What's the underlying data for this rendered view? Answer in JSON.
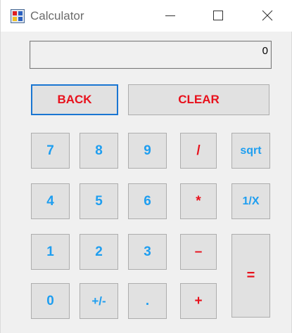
{
  "window": {
    "title": "Calculator"
  },
  "display": {
    "value": "0"
  },
  "buttons": {
    "back": "BACK",
    "clear": "CLEAR",
    "seven": "7",
    "eight": "8",
    "nine": "9",
    "divide": "/",
    "sqrt": "sqrt",
    "four": "4",
    "five": "5",
    "six": "6",
    "multiply": "*",
    "reciprocal": "1/X",
    "one": "1",
    "two": "2",
    "three": "3",
    "minus": "–",
    "equals": "=",
    "zero": "0",
    "negate": "+/-",
    "decimal": ".",
    "plus": "+"
  },
  "colors": {
    "digit": "#1e9ef0",
    "operator": "#e8111c",
    "focus": "#1a76d2"
  }
}
